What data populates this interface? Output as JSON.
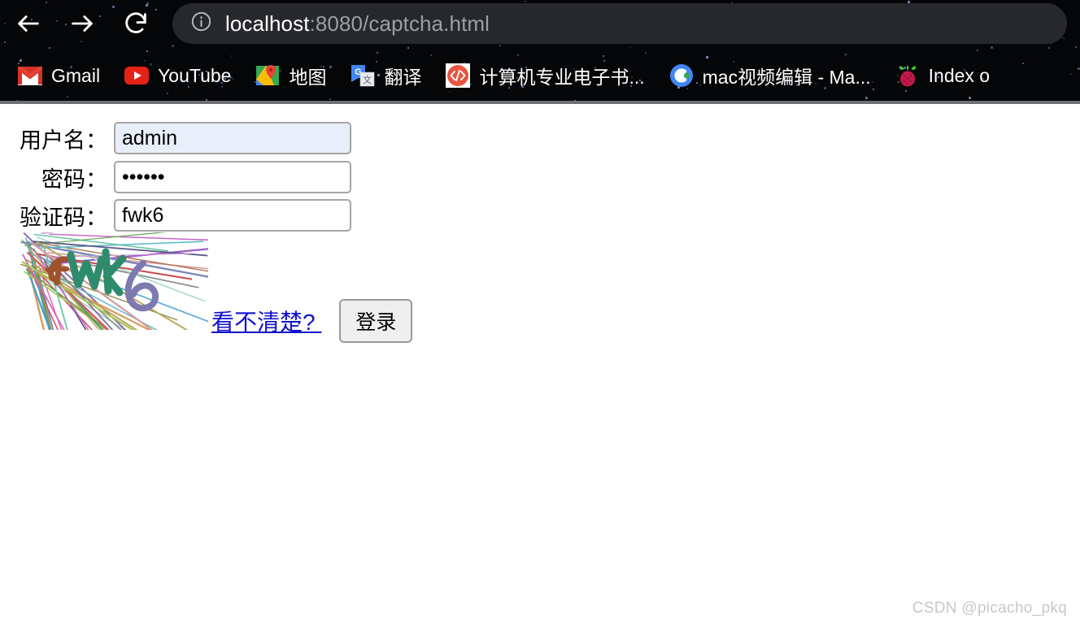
{
  "browser": {
    "nav": {
      "back_icon": "arrow-left-icon",
      "forward_icon": "arrow-right-icon",
      "reload_icon": "reload-icon"
    },
    "omnibox": {
      "info_icon": "info-circle-icon",
      "host": "localhost",
      "path": ":8080/captcha.html",
      "full_url": "localhost:8080/captcha.html"
    },
    "bookmarks": [
      {
        "label": "Gmail",
        "icon": "gmail-icon"
      },
      {
        "label": "YouTube",
        "icon": "youtube-icon"
      },
      {
        "label": "地图",
        "icon": "google-maps-icon"
      },
      {
        "label": "翻译",
        "icon": "google-translate-icon"
      },
      {
        "label": "计算机专业电子书...",
        "icon": "code-brackets-icon"
      },
      {
        "label": "mac视频编辑 - Ma...",
        "icon": "blue-circle-c-icon"
      },
      {
        "label": "Index o",
        "icon": "raspberry-pi-icon"
      }
    ],
    "colors": {
      "chrome_background": "#050608",
      "omnibox_background": "#26282b",
      "url_host": "#ffffff",
      "url_path": "#9aa0a6"
    }
  },
  "page": {
    "form": {
      "username": {
        "label": "用户名：",
        "value": "admin",
        "placeholder": ""
      },
      "password": {
        "label": "密码：",
        "value": "••••••",
        "masked_length": 6,
        "placeholder": ""
      },
      "captcha": {
        "label": "验证码：",
        "value": "fwk6",
        "placeholder": ""
      }
    },
    "captcha_image": {
      "name": "captcha-image",
      "text": "fwk6",
      "characters": [
        {
          "char": "f",
          "color": "#a0522d"
        },
        {
          "char": "w",
          "color": "#2e8b6b"
        },
        {
          "char": "k",
          "color": "#2e8b6b"
        },
        {
          "char": "6",
          "color": "#7d7ab0"
        }
      ]
    },
    "refresh_link": "看不清楚? ",
    "login_button": "登录",
    "watermark": "CSDN @picacho_pkq",
    "colors": {
      "autofill_background": "#e8eefa",
      "input_border": "#a5a5a5",
      "link": "#1111cc",
      "button_background": "#efefef",
      "watermark": "#c8c8c8"
    }
  }
}
